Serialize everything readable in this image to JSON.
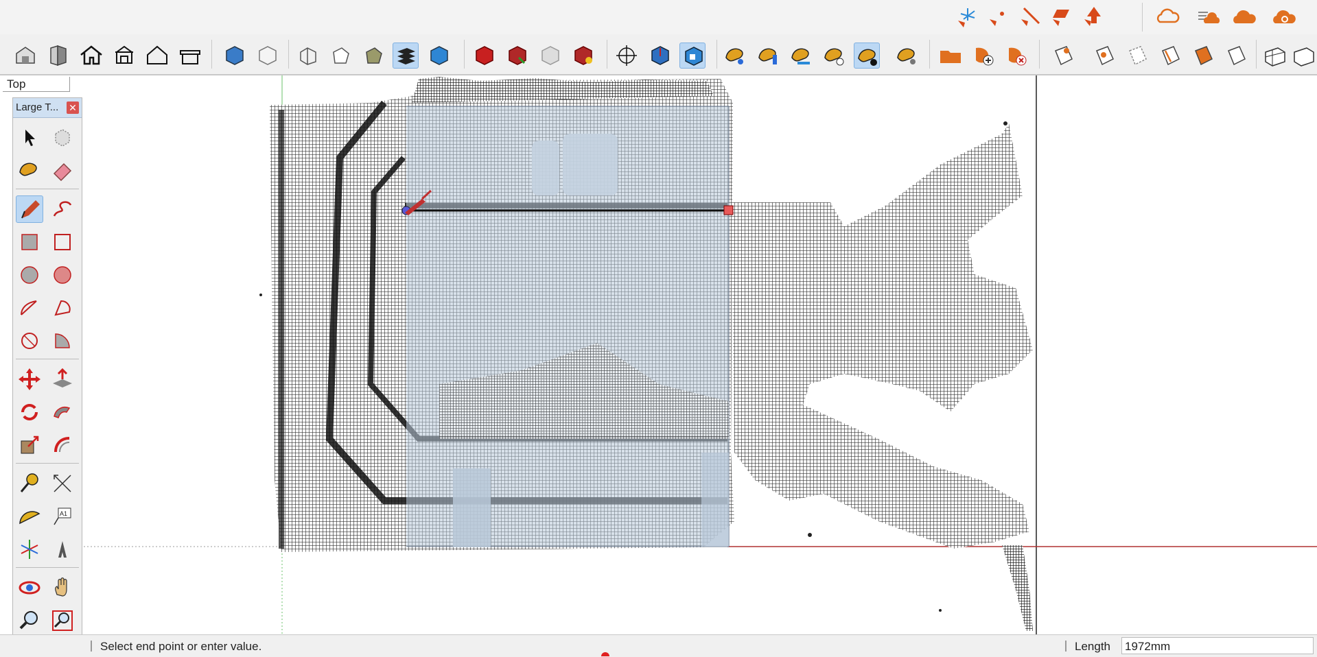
{
  "scene": {
    "tab_label": "Top"
  },
  "palette": {
    "title": "Large T...",
    "close_glyph": "✕"
  },
  "status": {
    "message": "Select end point or enter value.",
    "measure_label": "Length",
    "measure_value": "1972mm"
  },
  "toolbar_row1_icons": [
    "axes-tool-icon",
    "dimension-tool-icon",
    "line-tool-icon",
    "plane-tool-icon",
    "arrow-tool-icon",
    "cloud-outline-icon",
    "cloud-layers-icon",
    "cloud-solid-icon",
    "cloud-settings-icon"
  ],
  "toolbar_row2_icons": [
    "warehouse-icon",
    "store-icon",
    "house-icon",
    "house-alt-icon",
    "home-outline-icon",
    "garage-icon",
    "iso-view-icon",
    "front-view-icon",
    "wireframe-view-icon",
    "shaded-view-icon",
    "textured-view-icon",
    "layers-icon",
    "monochrome-icon",
    "section-plane-icon",
    "display-section-icon",
    "section-cut-icon",
    "section-fill-icon",
    "style-builder-icon",
    "position-camera-icon",
    "walk-icon",
    "look-around-icon",
    "paint-color-icon",
    "paint-texture-icon",
    "paint-water-icon",
    "paint-z-icon",
    "paint-contrast-icon",
    "paint-settings-icon",
    "open-folder-icon",
    "add-component-icon",
    "remove-component-icon",
    "tag-icon",
    "tag-view-icon",
    "tag-dashed-icon",
    "tag-edit-icon",
    "tag-color-icon",
    "tag-outline-icon",
    "scene-grid-icon",
    "scene-grid-alt-icon"
  ],
  "palette_icons": [
    "select-icon",
    "component-icon",
    "paint-bucket-icon",
    "eraser-icon",
    "pencil-icon",
    "freehand-icon",
    "rectangle-icon",
    "rotated-rectangle-icon",
    "circle-icon",
    "polygon-icon",
    "arc-icon",
    "pie-icon",
    "two-point-arc-icon",
    "three-point-arc-icon",
    "move-icon",
    "push-pull-icon",
    "rotate-icon",
    "follow-me-icon",
    "scale-icon",
    "offset-icon",
    "tape-measure-icon",
    "dimension-icon",
    "protractor-icon",
    "text-icon",
    "axes-icon",
    "3d-text-icon",
    "orbit-icon",
    "pan-icon",
    "zoom-icon",
    "zoom-window-icon",
    "zoom-extents-icon",
    "previous-view-icon"
  ],
  "colors": {
    "axis_red": "#c03030",
    "axis_green": "#30a030",
    "glass": "#b8c8d8",
    "cloud": "#1e1e1e",
    "accent": "#e07020"
  }
}
